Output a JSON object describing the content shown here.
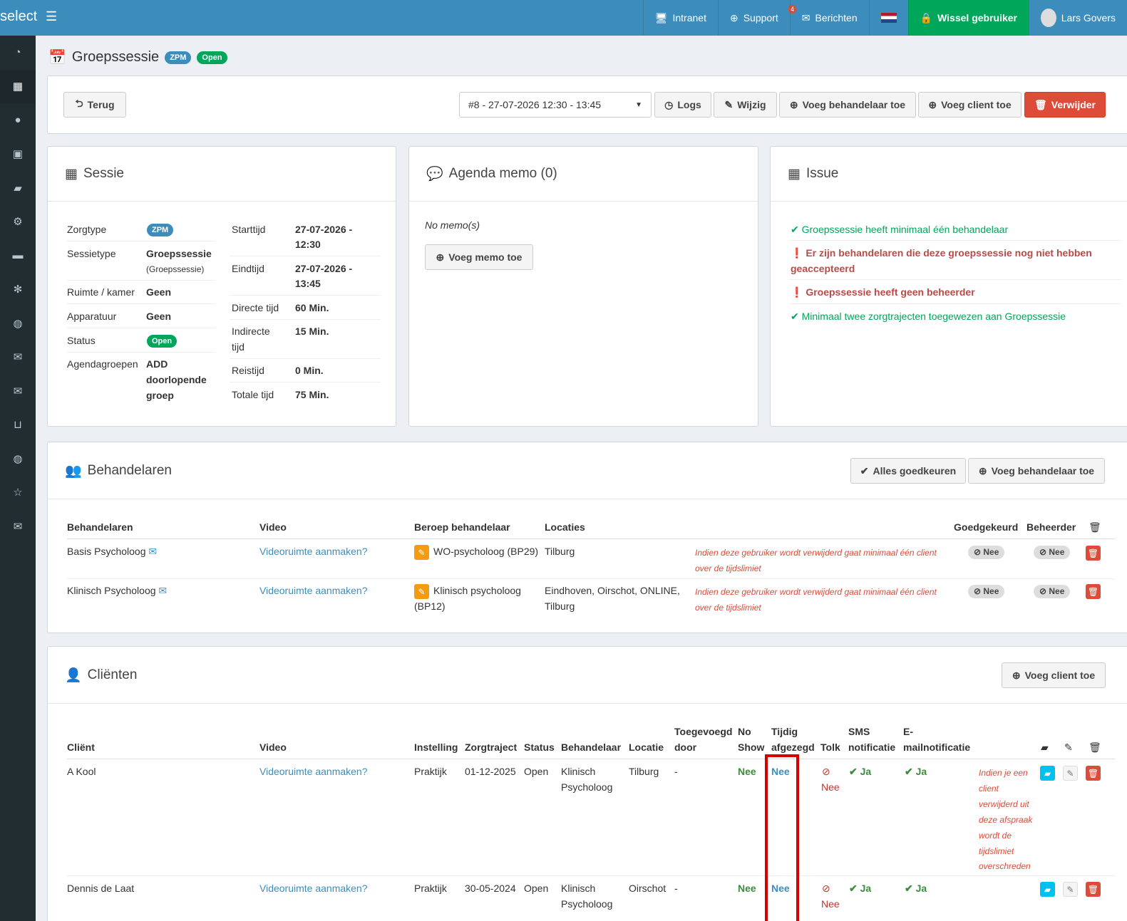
{
  "topbar": {
    "logo": "select",
    "intranet": "Intranet",
    "support": "Support",
    "support_badge": "4",
    "berichten": "Berichten",
    "wissel": "Wissel gebruiker",
    "user": "Lars Govers"
  },
  "sidebar_icons": [
    "dashboard-icon",
    "calendar-icon",
    "user-icon",
    "medkit-icon",
    "book-icon",
    "cogs-icon",
    "truck-icon",
    "cog-icon",
    "globe-icon",
    "envelope-icon",
    "envelope-icon",
    "inbox-icon",
    "globe-icon",
    "star-icon",
    "envelope-icon"
  ],
  "page": {
    "title": "Groepssessie",
    "badge_type": "ZPM",
    "badge_status": "Open"
  },
  "toolbar": {
    "back": "Terug",
    "session_select": "#8 - 27-07-2026 12:30 - 13:45",
    "logs": "Logs",
    "wijzig": "Wijzig",
    "add_practitioner": "Voeg behandelaar toe",
    "add_client": "Voeg client toe",
    "delete": "Verwijder"
  },
  "sessie": {
    "title": "Sessie",
    "zorgtype_label": "Zorgtype",
    "zorgtype": "ZPM",
    "sessietype_label": "Sessietype",
    "sessietype": "Groepssessie",
    "sessietype_sub": "(Groepssessie)",
    "ruimte_label": "Ruimte / kamer",
    "ruimte": "Geen",
    "apparatuur_label": "Apparatuur",
    "apparatuur": "Geen",
    "status_label": "Status",
    "status": "Open",
    "agenda_label": "Agendagroepen",
    "agenda_1": "ADD",
    "agenda_2": "doorlopende",
    "agenda_3": "groep",
    "start_label": "Starttijd",
    "start_1": "27-07-2026 -",
    "start_2": "12:30",
    "eind_label": "Eindtijd",
    "eind_1": "27-07-2026 -",
    "eind_2": "13:45",
    "direct_label": "Directe tijd",
    "direct": "60 Min.",
    "indirect_label_1": "Indirecte",
    "indirect_label_2": "tijd",
    "indirect": "15 Min.",
    "reis_label": "Reistijd",
    "reis": "0 Min.",
    "totaal_label": "Totale tijd",
    "totaal": "75 Min."
  },
  "memo": {
    "title": "Agenda memo (0)",
    "empty": "No memo(s)",
    "add": "Voeg memo toe"
  },
  "issue": {
    "title": "Issue",
    "i1": "Groepssessie heeft minimaal één behandelaar",
    "i2a": "Er zijn behandelaren die deze groepssessie nog niet hebben",
    "i2b": "geaccepteerd",
    "i3": "Groepssessie heeft geen beheerder",
    "i4": "Minimaal twee zorgtrajecten toegewezen aan Groepssessie"
  },
  "behandelaren": {
    "title": "Behandelaren",
    "approve_all": "Alles goedkeuren",
    "add": "Voeg behandelaar toe",
    "headers": {
      "name": "Behandelaren",
      "video": "Video",
      "beroep": "Beroep behandelaar",
      "locaties": "Locaties",
      "goedgekeurd": "Goedgekeurd",
      "beheerder": "Beheerder"
    },
    "rows": [
      {
        "name": "Basis Psycholoog",
        "video": "Videoruimte aanmaken?",
        "beroep_1": "WO-psycholoog (BP29)",
        "beroep_2": "",
        "loc_1": "Tilburg",
        "loc_2": "",
        "warn_1": "Indien deze gebruiker wordt verwijderd gaat minimaal één client",
        "warn_2": "over de tijdslimiet",
        "goed": "Nee",
        "beh": "Nee"
      },
      {
        "name": "Klinisch Psycholoog",
        "video": "Videoruimte aanmaken?",
        "beroep_1": "Klinisch psycholoog",
        "beroep_2": "(BP12)",
        "loc_1": "Eindhoven, Oirschot, ONLINE,",
        "loc_2": "Tilburg",
        "warn_1": "Indien deze gebruiker wordt verwijderd gaat minimaal één client",
        "warn_2": "over de tijdslimiet",
        "goed": "Nee",
        "beh": "Nee"
      }
    ]
  },
  "clienten": {
    "title": "Cliënten",
    "add": "Voeg client toe",
    "headers": {
      "client": "Cliënt",
      "video": "Video",
      "instelling": "Instelling",
      "zorgtraject": "Zorgtraject",
      "status": "Status",
      "behandelaar": "Behandelaar",
      "locatie": "Locatie",
      "toeg_1": "Toegevoegd",
      "toeg_2": "door",
      "noshow_1": "No",
      "noshow_2": "Show",
      "tijdig_1": "Tijdig",
      "tijdig_2": "afgezegd",
      "tolk": "Tolk",
      "sms_1": "SMS",
      "sms_2": "notificatie",
      "email_1": "E-",
      "email_2": "mailnotificatie"
    },
    "rows": [
      {
        "client": "A Kool",
        "video": "Videoruimte aanmaken?",
        "instelling": "Praktijk",
        "zorgtraject": "01-12-2025",
        "status": "Open",
        "beh_1": "Klinisch",
        "beh_2": "Psycholoog",
        "locatie": "Tilburg",
        "toeg": "-",
        "noshow": "Nee",
        "tijdig": "Nee",
        "tolk": "Nee",
        "sms": "Ja",
        "email": "Ja"
      },
      {
        "client": "Dennis de Laat",
        "video": "Videoruimte aanmaken?",
        "instelling": "Praktijk",
        "zorgtraject": "30-05-2024",
        "status": "Open",
        "beh_1": "Klinisch",
        "beh_2": "Psycholoog",
        "locatie": "Oirschot",
        "toeg": "-",
        "noshow": "Nee",
        "tijdig": "Nee",
        "tolk": "Nee",
        "sms": "Ja",
        "email": "Ja"
      }
    ],
    "warn": [
      "Indien je een",
      "client",
      "verwijderd uit",
      "deze afspraak",
      "wordt de",
      "tijdslimiet",
      "overschreden"
    ]
  }
}
